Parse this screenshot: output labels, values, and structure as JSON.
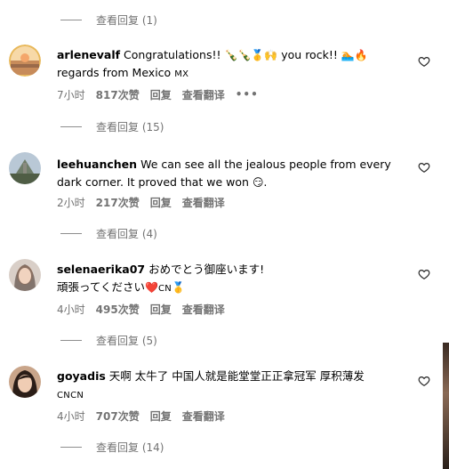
{
  "replies": [
    {
      "label": "查看回复 (1)"
    },
    {
      "label": "查看回复 (15)"
    },
    {
      "label": "查看回复 (4)"
    },
    {
      "label": "查看回复 (5)"
    },
    {
      "label": "查看回复 (14)"
    }
  ],
  "comments": [
    {
      "username": "arlenevalf",
      "text_1": "Congratulations!!",
      "emojis_1": "🍾🍾🥇🙌",
      "text_2": "you rock!!",
      "emojis_2": "🏊🔥",
      "text_3": "regards from Mexico",
      "country": "MX",
      "time": "7小时",
      "likes": "817次赞",
      "reply": "回复",
      "translate": "查看翻译",
      "more": "•••"
    },
    {
      "username": "leehuanchen",
      "text_1": "We can see all the jealous people from every dark corner. It proved that we won",
      "emojis_1": "😏.",
      "time": "2小时",
      "likes": "217次赞",
      "reply": "回复",
      "translate": "查看翻译"
    },
    {
      "username": "selenaerika07",
      "text_1": "おめでとう御座います!",
      "text_2": "頑張ってください",
      "emojis_1": "❤️",
      "country": "CN",
      "emojis_2": "🥇",
      "time": "4小时",
      "likes": "495次赞",
      "reply": "回复",
      "translate": "查看翻译"
    },
    {
      "username": "goyadis",
      "text_1": "天啊 太牛了 中国人就是能堂堂正正拿冠军 厚积薄发",
      "country": "CNCN",
      "time": "4小时",
      "likes": "707次赞",
      "reply": "回复",
      "translate": "查看翻译"
    }
  ],
  "icons": {
    "like": "heart-outline-icon",
    "more": "more-options-icon"
  },
  "colors": {
    "secondary_text": "#737373",
    "primary_text": "#000000",
    "background": "#ffffff"
  }
}
